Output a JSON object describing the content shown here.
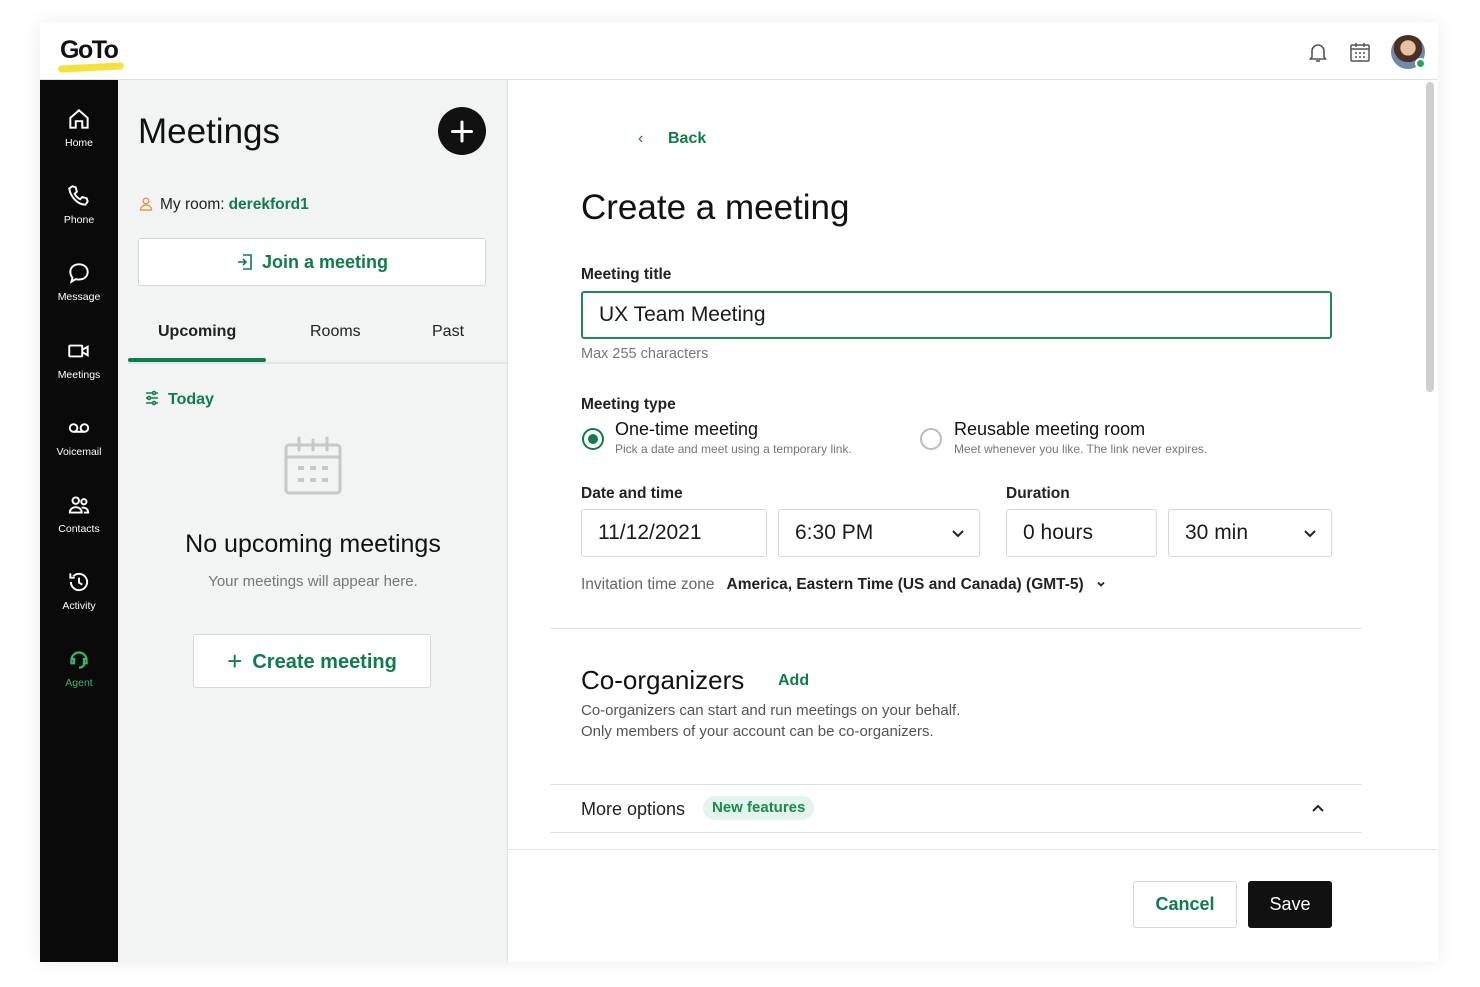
{
  "header": {
    "logo_text": "GoTo",
    "icons": [
      "bell-icon",
      "calendar-icon",
      "avatar"
    ]
  },
  "rail": {
    "items": [
      {
        "label": "Home",
        "icon": "home-icon"
      },
      {
        "label": "Phone",
        "icon": "phone-icon"
      },
      {
        "label": "Message",
        "icon": "message-icon"
      },
      {
        "label": "Meetings",
        "icon": "video-icon"
      },
      {
        "label": "Voicemail",
        "icon": "voicemail-icon"
      },
      {
        "label": "Contacts",
        "icon": "contacts-icon"
      },
      {
        "label": "Activity",
        "icon": "activity-icon"
      },
      {
        "label": "Agent",
        "icon": "agent-icon"
      }
    ]
  },
  "panel": {
    "title": "Meetings",
    "my_room_label": "My room:",
    "my_room_name": "derekford1",
    "join_label": "Join a meeting",
    "tabs": [
      "Upcoming",
      "Rooms",
      "Past"
    ],
    "today_label": "Today",
    "empty_title": "No upcoming meetings",
    "empty_sub": "Your meetings will appear here.",
    "create_label": "Create meeting"
  },
  "form": {
    "back_label": "Back",
    "title": "Create a meeting",
    "meeting_title_label": "Meeting title",
    "meeting_title_value": "UX Team Meeting",
    "meeting_title_hint": "Max 255 characters",
    "meeting_type_label": "Meeting type",
    "type_options": [
      {
        "title": "One-time meeting",
        "sub": "Pick a date and meet using a temporary link.",
        "selected": true
      },
      {
        "title": "Reusable meeting room",
        "sub": "Meet whenever you like. The link never expires.",
        "selected": false
      }
    ],
    "date_time_label": "Date and time",
    "date_value": "11/12/2021",
    "time_value": "6:30 PM",
    "duration_label": "Duration",
    "hours_value": "0 hours",
    "minutes_value": "30 min",
    "tz_label": "Invitation time zone",
    "tz_value": "America, Eastern Time (US and Canada) (GMT-5)",
    "coorg_title": "Co-organizers",
    "coorg_add": "Add",
    "coorg_sub1": "Co-organizers can start and run meetings on your behalf.",
    "coorg_sub2": "Only members of your account can be co-organizers.",
    "more_options": "More options",
    "new_features": "New features",
    "cancel_label": "Cancel",
    "save_label": "Save"
  },
  "colors": {
    "accent_green": "#0f7d4b",
    "rail_bg": "#0a0a0a",
    "logo_yellow": "#f5e13a"
  }
}
